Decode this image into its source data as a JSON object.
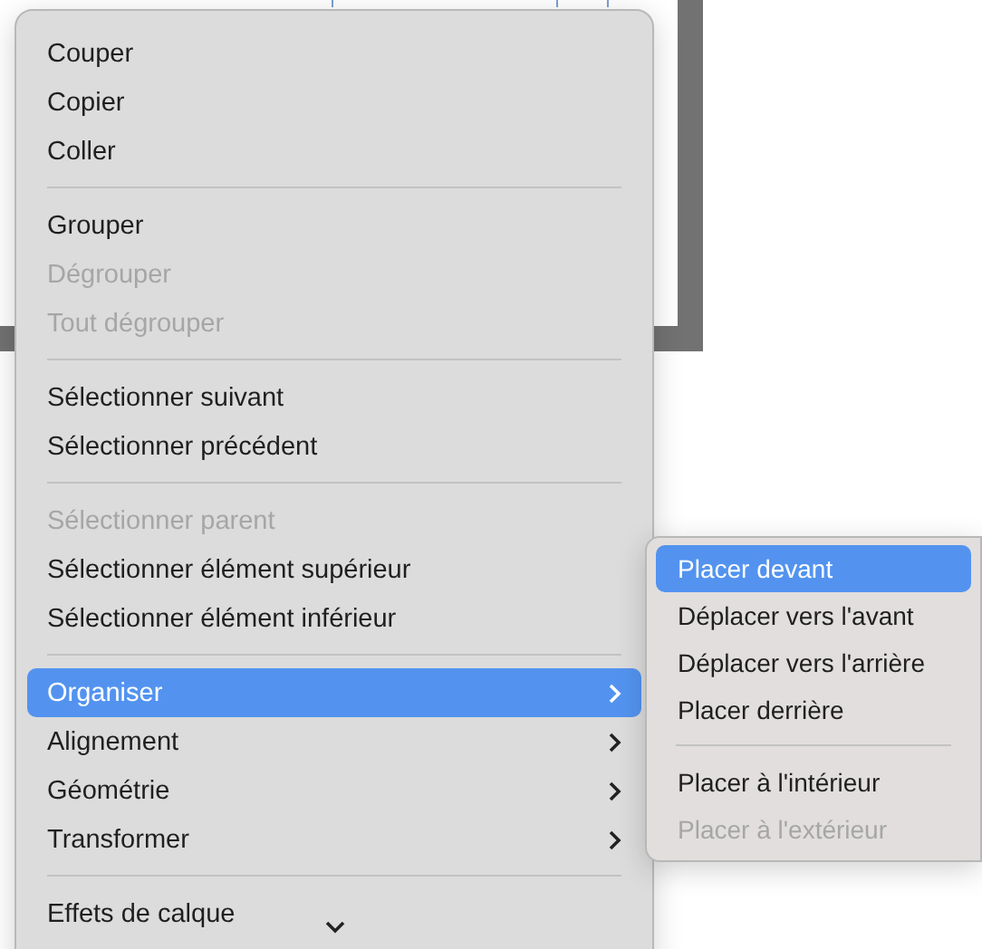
{
  "context_menu": {
    "items": [
      {
        "kind": "item",
        "label": "Couper",
        "disabled": false,
        "selected": false
      },
      {
        "kind": "item",
        "label": "Copier",
        "disabled": false,
        "selected": false
      },
      {
        "kind": "item",
        "label": "Coller",
        "disabled": false,
        "selected": false
      },
      {
        "kind": "separator"
      },
      {
        "kind": "item",
        "label": "Grouper",
        "disabled": false,
        "selected": false
      },
      {
        "kind": "item",
        "label": "Dégrouper",
        "disabled": true,
        "selected": false
      },
      {
        "kind": "item",
        "label": "Tout dégrouper",
        "disabled": true,
        "selected": false
      },
      {
        "kind": "separator"
      },
      {
        "kind": "item",
        "label": "Sélectionner suivant",
        "disabled": false,
        "selected": false
      },
      {
        "kind": "item",
        "label": "Sélectionner précédent",
        "disabled": false,
        "selected": false
      },
      {
        "kind": "separator"
      },
      {
        "kind": "item",
        "label": "Sélectionner parent",
        "disabled": true,
        "selected": false
      },
      {
        "kind": "item",
        "label": "Sélectionner élément supérieur",
        "disabled": false,
        "selected": false
      },
      {
        "kind": "item",
        "label": "Sélectionner élément inférieur",
        "disabled": false,
        "selected": false
      },
      {
        "kind": "separator"
      },
      {
        "kind": "submenu",
        "label": "Organiser",
        "disabled": false,
        "selected": true
      },
      {
        "kind": "submenu",
        "label": "Alignement",
        "disabled": false,
        "selected": false
      },
      {
        "kind": "submenu",
        "label": "Géométrie",
        "disabled": false,
        "selected": false
      },
      {
        "kind": "submenu",
        "label": "Transformer",
        "disabled": false,
        "selected": false
      },
      {
        "kind": "separator"
      },
      {
        "kind": "item",
        "label": "Effets de calque",
        "disabled": false,
        "selected": false
      }
    ]
  },
  "submenu": {
    "items": [
      {
        "kind": "item",
        "label": "Placer devant",
        "disabled": false,
        "selected": true
      },
      {
        "kind": "item",
        "label": "Déplacer vers l'avant",
        "disabled": false,
        "selected": false
      },
      {
        "kind": "item",
        "label": "Déplacer vers l'arrière",
        "disabled": false,
        "selected": false
      },
      {
        "kind": "item",
        "label": "Placer derrière",
        "disabled": false,
        "selected": false
      },
      {
        "kind": "separator"
      },
      {
        "kind": "item",
        "label": "Placer à l'intérieur",
        "disabled": false,
        "selected": false
      },
      {
        "kind": "item",
        "label": "Placer à l'extérieur",
        "disabled": true,
        "selected": false
      }
    ]
  }
}
